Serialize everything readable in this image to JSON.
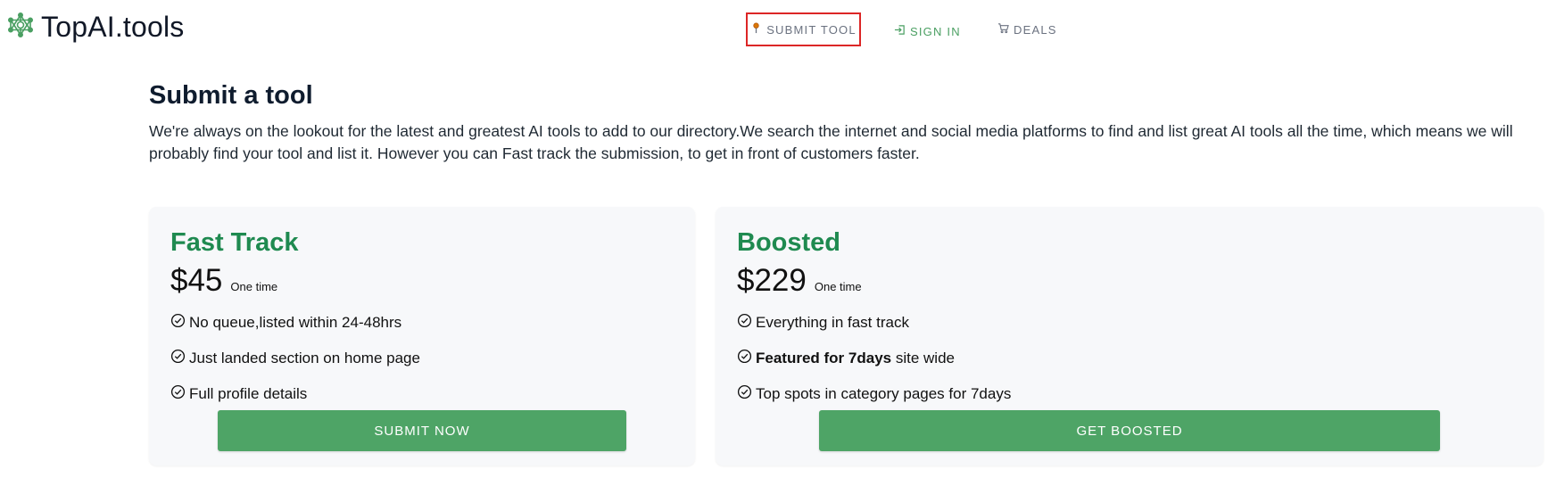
{
  "header": {
    "brand": "TopAI.tools",
    "logo_icon": "network-logo-icon",
    "nav": {
      "submit_tool": "Submit Tool",
      "sign_in": "Sign In",
      "deals": "Deals"
    }
  },
  "main": {
    "title": "Submit a tool",
    "intro": "We're always on the lookout for the latest and greatest AI tools to add to our directory.We search the internet and social media platforms to find and list great AI tools all the time, which means we will probably find your tool and list it. However you can Fast track the submission, to get in front of customers faster."
  },
  "plans": {
    "fast_track": {
      "name": "Fast Track",
      "price": "$45",
      "price_note": "One time",
      "features": [
        "No queue,listed within 24-48hrs",
        "Just landed section on home page",
        "Full profile details"
      ],
      "cta": "Submit Now"
    },
    "boosted": {
      "name": "Boosted",
      "price": "$229",
      "price_note": "One time",
      "features": [
        "Everything in fast track",
        {
          "bold": "Featured for 7days",
          "rest": " site wide"
        },
        "Top spots in category pages for 7days"
      ],
      "cta": "Get Boosted"
    }
  },
  "colors": {
    "brand_green": "#1f8a50",
    "button_green": "#4ea466",
    "highlight_border": "#dc2626"
  }
}
